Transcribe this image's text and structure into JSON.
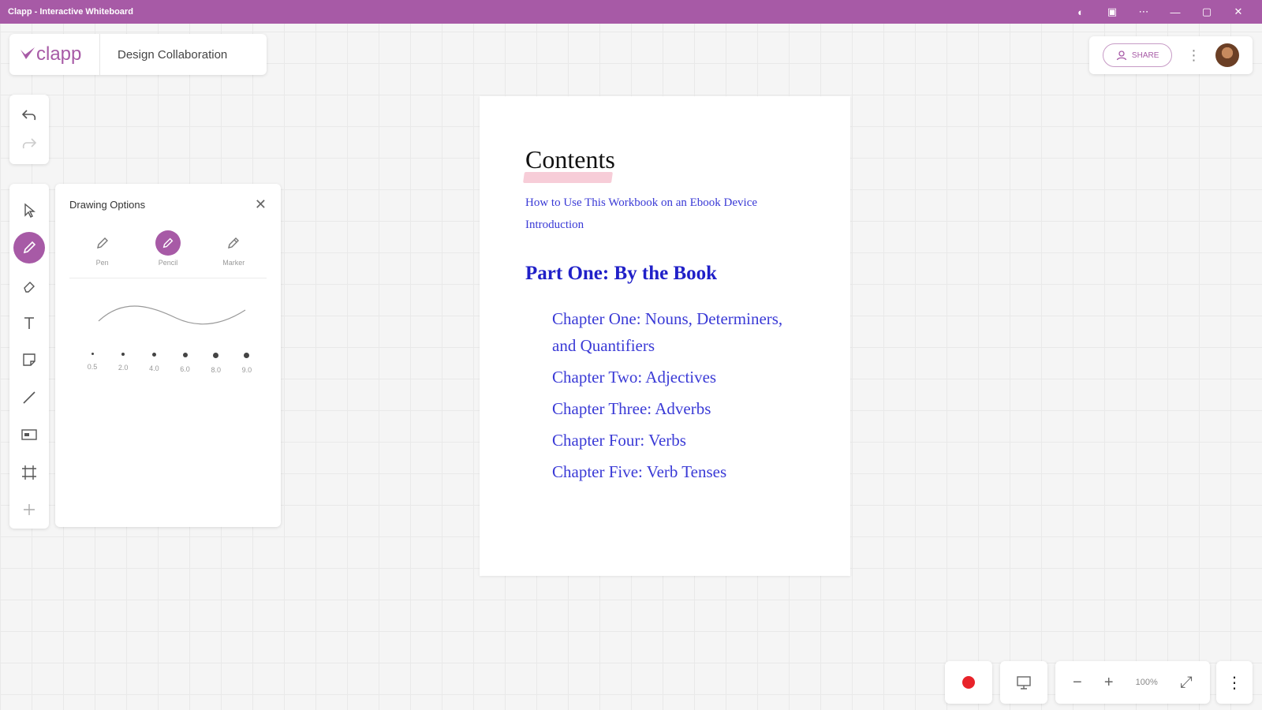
{
  "window": {
    "title": "Clapp - Interactive Whiteboard",
    "controls": [
      "◐",
      "▣",
      "⋯",
      "—",
      "▢",
      "✕"
    ]
  },
  "brand": {
    "logo_text": "clapp",
    "board_title": "Design Collaboration"
  },
  "header_right": {
    "share_label": "SHARE"
  },
  "drawing_options": {
    "title": "Drawing Options",
    "brushes": [
      {
        "label": "Pen",
        "icon": "pen-icon"
      },
      {
        "label": "Pencil",
        "icon": "pencil-icon",
        "active": true
      },
      {
        "label": "Marker",
        "icon": "marker-icon"
      }
    ],
    "sizes": [
      "0.5",
      "2.0",
      "4.0",
      "6.0",
      "8.0",
      "9.0"
    ]
  },
  "document": {
    "title": "Contents",
    "front_links": [
      "How to Use This Workbook on an Ebook Device",
      "Introduction"
    ],
    "part_heading": "Part One: By the Book",
    "chapters": [
      "Chapter One: Nouns, Determiners, and Quantifiers",
      "Chapter Two: Adjectives",
      "Chapter Three: Adverbs",
      "Chapter Four: Verbs",
      "Chapter Five: Verb Tenses"
    ]
  },
  "bottom": {
    "zoom_level": "100%"
  },
  "colors": {
    "accent": "#a75aa6",
    "link": "#3a3ad6",
    "record": "#e8232a",
    "highlight": "#f7cdd8"
  }
}
